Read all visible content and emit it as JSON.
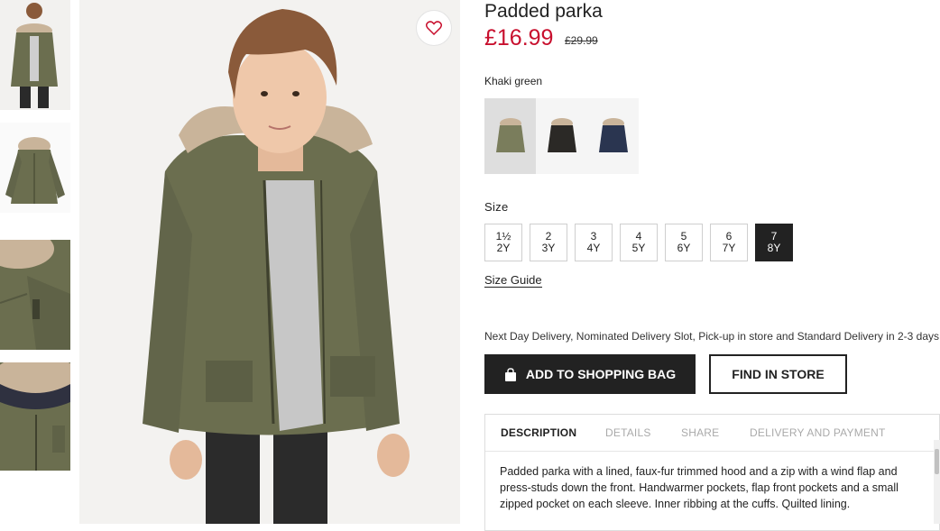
{
  "product": {
    "title": "Padded parka",
    "price": "£16.99",
    "old_price": "£29.99",
    "color_name": "Khaki green",
    "favourite_icon": "heart-icon"
  },
  "thumbnails": [
    {
      "name": "thumb-front-full",
      "selected": true
    },
    {
      "name": "thumb-flat-parka"
    },
    {
      "name": "thumb-sleeve-detail"
    },
    {
      "name": "thumb-hood-detail"
    }
  ],
  "swatches": [
    {
      "name": "Khaki green",
      "color": "#7a7d5c",
      "selected": true
    },
    {
      "name": "Black",
      "color": "#2b2926"
    },
    {
      "name": "Dark blue",
      "color": "#2a3550"
    }
  ],
  "sizes": {
    "label": "Size",
    "options": [
      {
        "top": "1½",
        "bottom": "2Y"
      },
      {
        "top": "2",
        "bottom": "3Y"
      },
      {
        "top": "3",
        "bottom": "4Y"
      },
      {
        "top": "4",
        "bottom": "5Y"
      },
      {
        "top": "5",
        "bottom": "6Y"
      },
      {
        "top": "6",
        "bottom": "7Y"
      },
      {
        "top": "7",
        "bottom": "8Y",
        "selected": true
      }
    ],
    "guide_label": "Size Guide"
  },
  "delivery_text": "Next Day Delivery, Nominated Delivery Slot, Pick-up in store and Standard Delivery in 2-3 days.",
  "buttons": {
    "add_to_bag": "ADD TO SHOPPING BAG",
    "add_to_bag_icon": "shopping-bag-icon",
    "find_in_store": "FIND IN STORE"
  },
  "tabs": [
    {
      "label": "DESCRIPTION",
      "active": true
    },
    {
      "label": "DETAILS"
    },
    {
      "label": "SHARE"
    },
    {
      "label": "DELIVERY AND PAYMENT"
    }
  ],
  "description": "Padded parka with a lined, faux-fur trimmed hood and a zip with a wind flap and press-studs down the front. Handwarmer pockets, flap front pockets and a small zipped pocket on each sleeve. Inner ribbing at the cuffs. Quilted lining.",
  "colors": {
    "price": "#c8102e",
    "parka_khaki": "#6b6e4f",
    "fur": "#c9b49a",
    "button_dark": "#222222"
  }
}
